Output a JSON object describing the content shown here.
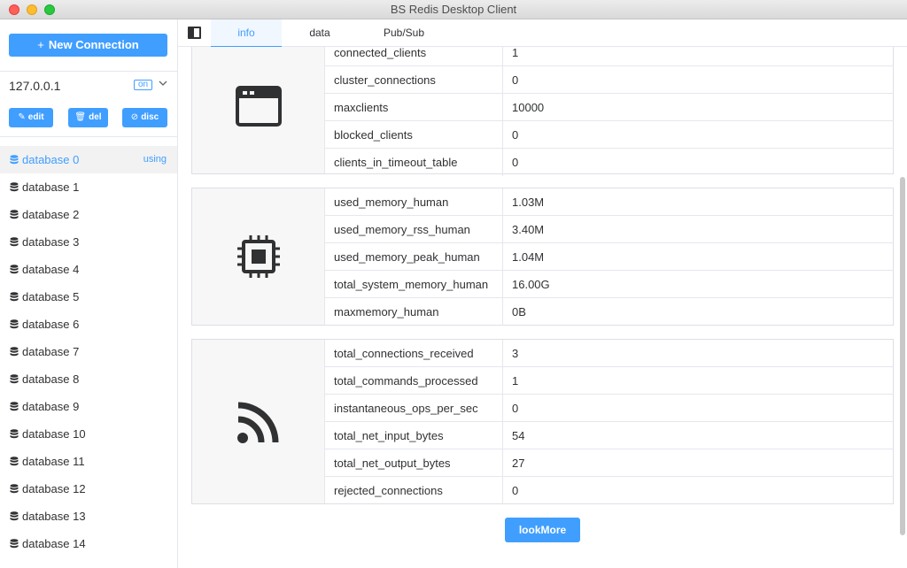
{
  "window": {
    "title": "BS Redis Desktop Client"
  },
  "sidebar": {
    "new_connection_label": "New Connection",
    "connection": {
      "name": "127.0.0.1",
      "status": "on"
    },
    "buttons": {
      "edit": "edit",
      "del": "del",
      "disc": "disc"
    },
    "databases": [
      {
        "label": "database 0",
        "badge": "using"
      },
      {
        "label": "database 1"
      },
      {
        "label": "database 2"
      },
      {
        "label": "database 3"
      },
      {
        "label": "database 4"
      },
      {
        "label": "database 5"
      },
      {
        "label": "database 6"
      },
      {
        "label": "database 7"
      },
      {
        "label": "database 8"
      },
      {
        "label": "database 9"
      },
      {
        "label": "database 10"
      },
      {
        "label": "database 11"
      },
      {
        "label": "database 12"
      },
      {
        "label": "database 13"
      },
      {
        "label": "database 14"
      }
    ]
  },
  "tabs": [
    {
      "label": "info",
      "active": true
    },
    {
      "label": "data"
    },
    {
      "label": "Pub/Sub"
    }
  ],
  "sections": {
    "clients": {
      "icon": "window-icon",
      "rows": [
        {
          "key": "connected_clients",
          "value": "1"
        },
        {
          "key": "cluster_connections",
          "value": "0"
        },
        {
          "key": "maxclients",
          "value": "10000"
        },
        {
          "key": "blocked_clients",
          "value": "0"
        },
        {
          "key": "clients_in_timeout_table",
          "value": "0"
        }
      ]
    },
    "memory": {
      "icon": "cpu-chip-icon",
      "rows": [
        {
          "key": "used_memory_human",
          "value": "1.03M"
        },
        {
          "key": "used_memory_rss_human",
          "value": "3.40M"
        },
        {
          "key": "used_memory_peak_human",
          "value": "1.04M"
        },
        {
          "key": "total_system_memory_human",
          "value": "16.00G"
        },
        {
          "key": "maxmemory_human",
          "value": "0B"
        }
      ]
    },
    "stats": {
      "icon": "rss-icon",
      "rows": [
        {
          "key": "total_connections_received",
          "value": "3"
        },
        {
          "key": "total_commands_processed",
          "value": "1"
        },
        {
          "key": "instantaneous_ops_per_sec",
          "value": "0"
        },
        {
          "key": "total_net_input_bytes",
          "value": "54"
        },
        {
          "key": "total_net_output_bytes",
          "value": "27"
        },
        {
          "key": "rejected_connections",
          "value": "0"
        }
      ]
    }
  },
  "look_more_label": "lookMore",
  "colors": {
    "accent": "#409eff",
    "active_row_bg": "#f2f2f2",
    "icon_panel_bg": "#f7f7f7"
  }
}
